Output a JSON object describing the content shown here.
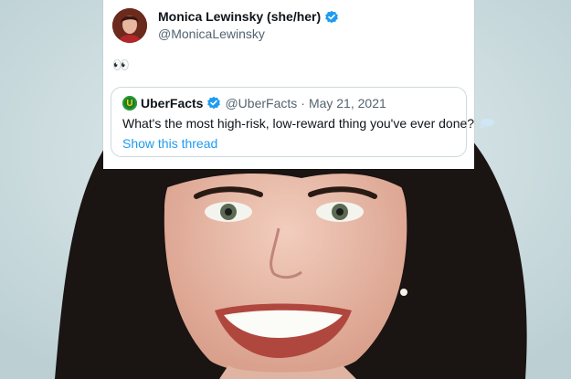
{
  "tweet": {
    "author_name": "Monica Lewinsky (she/her)",
    "author_handle": "@MonicaLewinsky",
    "text": "👀",
    "verified_icon": "verified-badge-icon",
    "avatar_icon": "avatar",
    "quoted": {
      "author_name": "UberFacts",
      "author_handle": "@UberFacts",
      "separator": "·",
      "date": "May 21, 2021",
      "text": "What's the most high-risk, low-reward thing you've ever done?",
      "emoji_icon": "thought-bubble-icon",
      "show_thread_label": "Show this thread"
    }
  },
  "colors": {
    "link": "#1d9bf0",
    "text": "#0f1419",
    "muted": "#536471",
    "border": "#cfd9de",
    "verified": "#1d9bf0",
    "photo_background": "#cfe0e3"
  }
}
